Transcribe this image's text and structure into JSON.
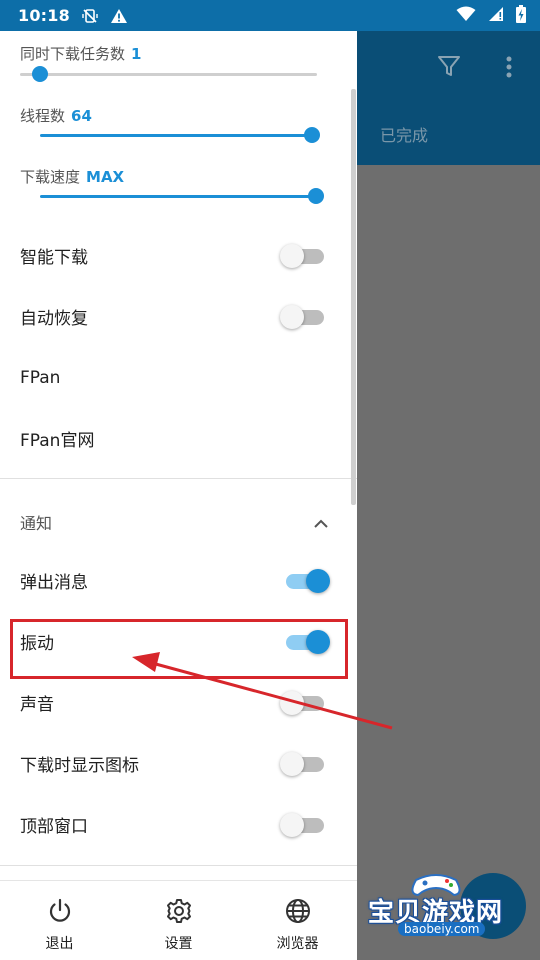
{
  "status_bar": {
    "time": "10:18",
    "icons": [
      "vibrate-mute-icon",
      "warning-icon",
      "wifi-icon",
      "signal-icon",
      "battery-icon"
    ]
  },
  "background_app": {
    "tab_label": "已完成",
    "toolbar_icons": [
      "filter-icon",
      "more-vert-icon"
    ],
    "colors": {
      "toolbar": "#0a4e76",
      "scrim": "#6e6e6e"
    }
  },
  "drawer": {
    "sliders": [
      {
        "label": "同时下载任务数",
        "value": "1",
        "level": 0.0
      },
      {
        "label": "线程数",
        "value": "64",
        "level": 1.0
      },
      {
        "label": "下载速度",
        "value": "MAX",
        "level": 1.0
      }
    ],
    "settings": [
      {
        "label": "智能下载",
        "toggle": "off"
      },
      {
        "label": "自动恢复",
        "toggle": "off"
      },
      {
        "label": "FPan"
      },
      {
        "label": "FPan官网"
      }
    ],
    "notification_section": {
      "title": "通知",
      "expanded": true,
      "items": [
        {
          "label": "弹出消息",
          "toggle": "on"
        },
        {
          "label": "振动",
          "toggle": "on"
        },
        {
          "label": "声音",
          "toggle": "off"
        },
        {
          "label": "下载时显示图标",
          "toggle": "off"
        },
        {
          "label": "顶部窗口",
          "toggle": "off"
        }
      ]
    },
    "accent_color": "#1b8fd6"
  },
  "bottom_nav": [
    {
      "label": "退出",
      "icon": "power-icon"
    },
    {
      "label": "设置",
      "icon": "gear-icon"
    },
    {
      "label": "浏览器",
      "icon": "globe-icon"
    }
  ],
  "annotation": {
    "highlight_color": "#d7262b"
  },
  "watermark": {
    "title": "宝贝游戏网",
    "url": "baobeiy.com"
  }
}
